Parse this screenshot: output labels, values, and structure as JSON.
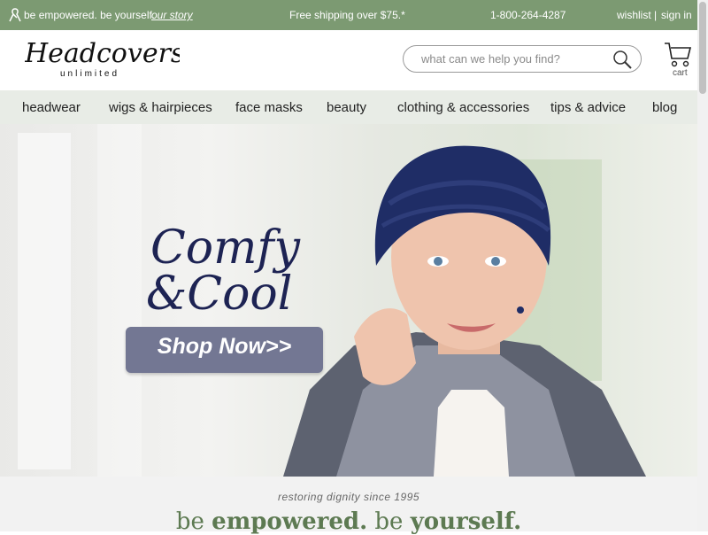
{
  "topbar": {
    "be1": "be",
    "empowered": "empowered.",
    "be2": "be",
    "yourself": "yourself.",
    "story": "our story",
    "shipping": "Free shipping over $75.*",
    "phone": "1-800-264-4287",
    "wishlist": "wishlist |",
    "signin": "sign in"
  },
  "header": {
    "logo_main": "Headcovers",
    "logo_sub": "unlimited",
    "search_placeholder": "what can we help you find?",
    "cart_label": "cart"
  },
  "nav": [
    "headwear",
    "wigs & hairpieces",
    "face masks",
    "beauty",
    "clothing & accessories",
    "tips & advice",
    "blog"
  ],
  "hero": {
    "line1": "Comfy",
    "line2": "&Cool",
    "cta": "Shop Now>>"
  },
  "below": {
    "restoring": "restoring dignity since 1995",
    "be1": "be",
    "empowered": "empowered.",
    "be2": "be",
    "yourself": "yourself."
  },
  "colors": {
    "brand_green": "#7c9a72",
    "nav_bg": "#e8ece6",
    "hero_text": "#1d2353",
    "cta_bg": "#737793",
    "tagline_green": "#5d7a52"
  }
}
